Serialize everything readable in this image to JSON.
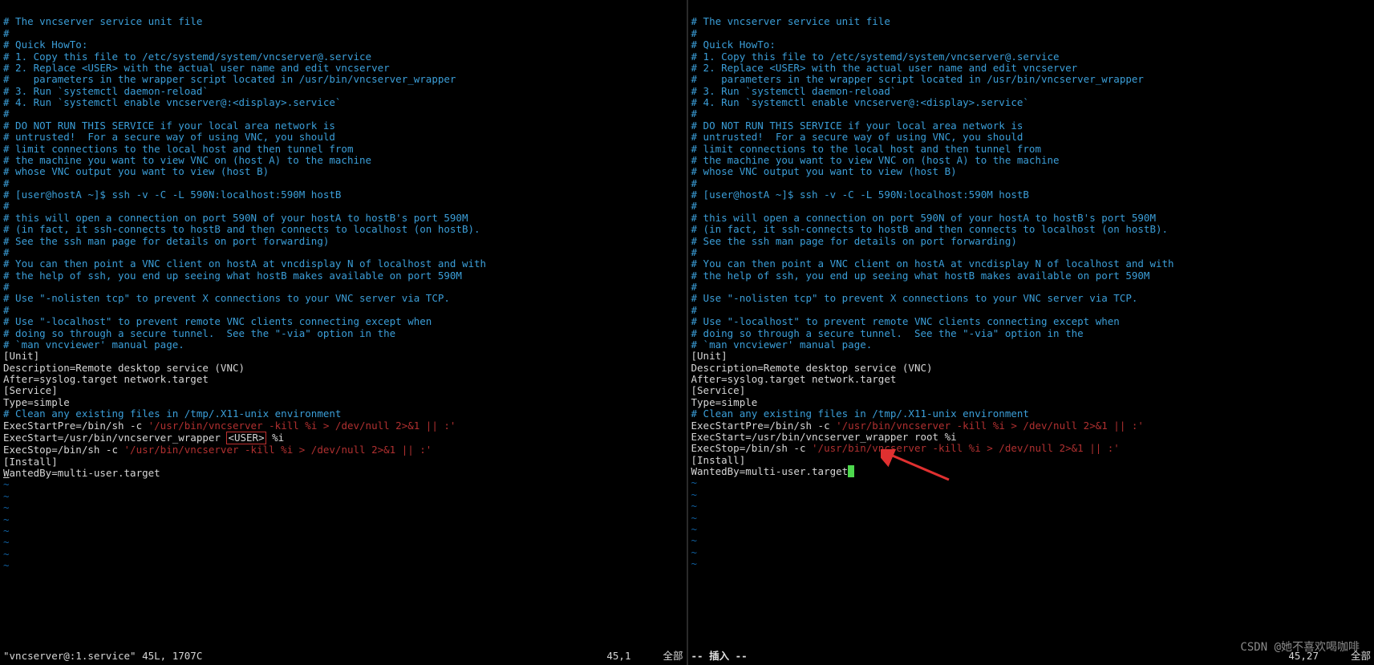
{
  "comments": [
    "# The vncserver service unit file",
    "#",
    "# Quick HowTo:",
    "# 1. Copy this file to /etc/systemd/system/vncserver@.service",
    "# 2. Replace <USER> with the actual user name and edit vncserver",
    "#    parameters in the wrapper script located in /usr/bin/vncserver_wrapper",
    "# 3. Run `systemctl daemon-reload`",
    "# 4. Run `systemctl enable vncserver@:<display>.service`",
    "#",
    "# DO NOT RUN THIS SERVICE if your local area network is",
    "# untrusted!  For a secure way of using VNC, you should",
    "# limit connections to the local host and then tunnel from",
    "# the machine you want to view VNC on (host A) to the machine",
    "# whose VNC output you want to view (host B)",
    "#",
    "# [user@hostA ~]$ ssh -v -C -L 590N:localhost:590M hostB",
    "#",
    "# this will open a connection on port 590N of your hostA to hostB's port 590M",
    "# (in fact, it ssh-connects to hostB and then connects to localhost (on hostB).",
    "# See the ssh man page for details on port forwarding)",
    "#",
    "# You can then point a VNC client on hostA at vncdisplay N of localhost and with",
    "# the help of ssh, you end up seeing what hostB makes available on port 590M",
    "#",
    "# Use \"-nolisten tcp\" to prevent X connections to your VNC server via TCP.",
    "#",
    "# Use \"-localhost\" to prevent remote VNC clients connecting except when",
    "# doing so through a secure tunnel.  See the \"-via\" option in the",
    "# `man vncviewer' manual page."
  ],
  "unit_header": "[Unit]",
  "unit_desc": "Description=Remote desktop service (VNC)",
  "unit_after": "After=syslog.target network.target",
  "service_header": "[Service]",
  "service_type": "Type=simple",
  "clean_comment": "# Clean any existing files in /tmp/.X11-unix environment",
  "execstartpre_a": "ExecStartPre=/bin/sh -c ",
  "execstartpre_b": "'/usr/bin/vncserver -kill %i > /dev/null 2>&1 || :'",
  "left_execstart_a": "ExecStart=/usr/bin/vncserver_wrapper ",
  "left_execstart_user": "<USER>",
  "left_execstart_b": " %i",
  "right_execstart": "ExecStart=/usr/bin/vncserver_wrapper root %i",
  "execstop_a": "ExecStop=/bin/sh -c ",
  "execstop_b": "'/usr/bin/vncserver -kill %i > /dev/null 2>&1 || :'",
  "install_header": "[Install]",
  "wantedby_left_a": "W",
  "wantedby_left_b": "antedBy=multi-user.target",
  "wantedby_right": "WantedBy=multi-user.target",
  "tilde": "~",
  "left_status_file": "\"vncserver@:1.service\" 45L, 1707C",
  "left_status_pos": "45,1",
  "left_status_all": "全部",
  "right_status_mode": "-- 插入 --",
  "right_status_pos": "45,27",
  "right_status_all": "全部",
  "watermark": "CSDN @她不喜欢喝咖啡"
}
